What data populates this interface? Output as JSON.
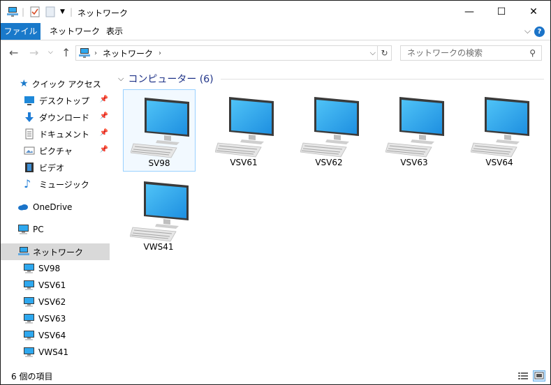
{
  "window": {
    "title": "ネットワーク",
    "controls": {
      "minimize": "—",
      "maximize": "☐",
      "close": "✕"
    }
  },
  "ribbon": {
    "tabs": [
      "ファイル",
      "ネットワーク",
      "表示"
    ],
    "help": "?"
  },
  "address": {
    "path": [
      "ネットワーク"
    ],
    "search_placeholder": "ネットワークの検索"
  },
  "sidebar": {
    "quick_access": {
      "label": "クイック アクセス",
      "items": [
        {
          "label": "デスクトップ",
          "icon": "desktop-icon",
          "pinned": true
        },
        {
          "label": "ダウンロード",
          "icon": "download-icon",
          "pinned": true
        },
        {
          "label": "ドキュメント",
          "icon": "document-icon",
          "pinned": true
        },
        {
          "label": "ピクチャ",
          "icon": "picture-icon",
          "pinned": true
        },
        {
          "label": "ビデオ",
          "icon": "video-icon",
          "pinned": false
        },
        {
          "label": "ミュージック",
          "icon": "music-icon",
          "pinned": false
        }
      ]
    },
    "onedrive": "OneDrive",
    "pc": "PC",
    "network": {
      "label": "ネットワーク",
      "items": [
        "SV98",
        "VSV61",
        "VSV62",
        "VSV63",
        "VSV64",
        "VWS41"
      ]
    }
  },
  "content": {
    "group_label": "コンピューター (6)",
    "computers": [
      "SV98",
      "VSV61",
      "VSV62",
      "VSV63",
      "VSV64",
      "VWS41"
    ],
    "selected": "SV98"
  },
  "status": {
    "item_count": "6 個の項目"
  },
  "colors": {
    "accent": "#1979ca",
    "group_text": "#1e3287",
    "selection_border": "#99d1ff",
    "nav_selected": "#d9d9d9"
  }
}
